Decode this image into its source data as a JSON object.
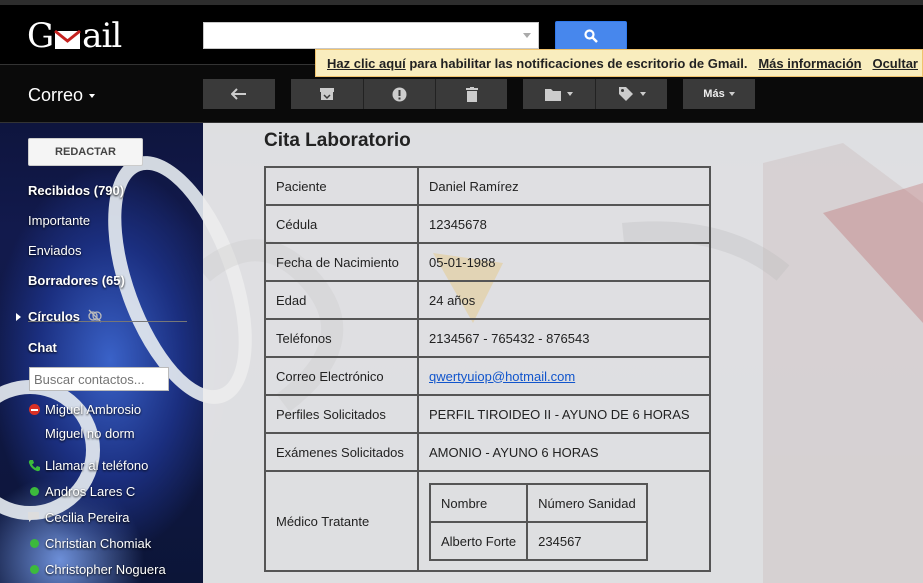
{
  "app": {
    "logo": "Gmail"
  },
  "search": {
    "value": "",
    "placeholder": ""
  },
  "notification": {
    "link_text": "Haz clic aquí",
    "message": " para habilitar las notificaciones de escritorio de Gmail.",
    "more_info": "Más información",
    "hide": "Ocultar"
  },
  "header": {
    "mail_menu": "Correo"
  },
  "toolbar": {
    "more_label": "Más",
    "icons": [
      "reply-icon",
      "archive-icon",
      "report-spam-icon",
      "delete-icon",
      "folder-icon",
      "label-icon"
    ]
  },
  "sidebar": {
    "compose_label": "REDACTAR",
    "items": [
      {
        "label": "Recibidos (790)",
        "bold": true
      },
      {
        "label": "Importante",
        "bold": false
      },
      {
        "label": "Enviados",
        "bold": false
      },
      {
        "label": "Borradores (65)",
        "bold": true
      },
      {
        "label": "Círculos",
        "bold": true
      }
    ],
    "chat_heading": "Chat",
    "chat_search_placeholder": "Buscar contactos...",
    "contacts": [
      {
        "name": "Miguel Ambrosio",
        "status": "busy"
      },
      {
        "name": "Miguel no dorm",
        "status": "none"
      },
      {
        "name": "Llamar al teléfono",
        "status": "phone"
      },
      {
        "name": "Andros Lares C",
        "status": "available"
      },
      {
        "name": "Cecilia Pereira",
        "status": "mobile"
      },
      {
        "name": "Christian Chomiak",
        "status": "available"
      },
      {
        "name": "Christopher Noguera",
        "status": "available"
      }
    ]
  },
  "email": {
    "subject": "Cita Laboratorio",
    "fields": [
      {
        "label": "Paciente",
        "value": "Daniel Ramírez"
      },
      {
        "label": "Cédula",
        "value": "12345678"
      },
      {
        "label": "Fecha de Nacimiento",
        "value": "05-01-1988"
      },
      {
        "label": "Edad",
        "value": "24 años"
      },
      {
        "label": "Teléfonos",
        "value": "2134567 - 765432 - 876543"
      },
      {
        "label": "Correo Electrónico",
        "value": "qwertyuiop@hotmail.com"
      },
      {
        "label": "Perfiles Solicitados",
        "value": "PERFIL TIROIDEO II - AYUNO DE 6 HORAS"
      },
      {
        "label": "Exámenes Solicitados",
        "value": "AMONIO - AYUNO 6 HORAS"
      }
    ],
    "doctor": {
      "label": "Médico Tratante",
      "headers": [
        "Nombre",
        "Número Sanidad"
      ],
      "row": [
        "Alberto Forte",
        "234567"
      ]
    }
  },
  "colors": {
    "search_button": "#4787ed",
    "notification_bg": "#f9edbe",
    "link": "#1155cc",
    "status_available": "#3cba3c",
    "status_busy": "#d93025"
  }
}
